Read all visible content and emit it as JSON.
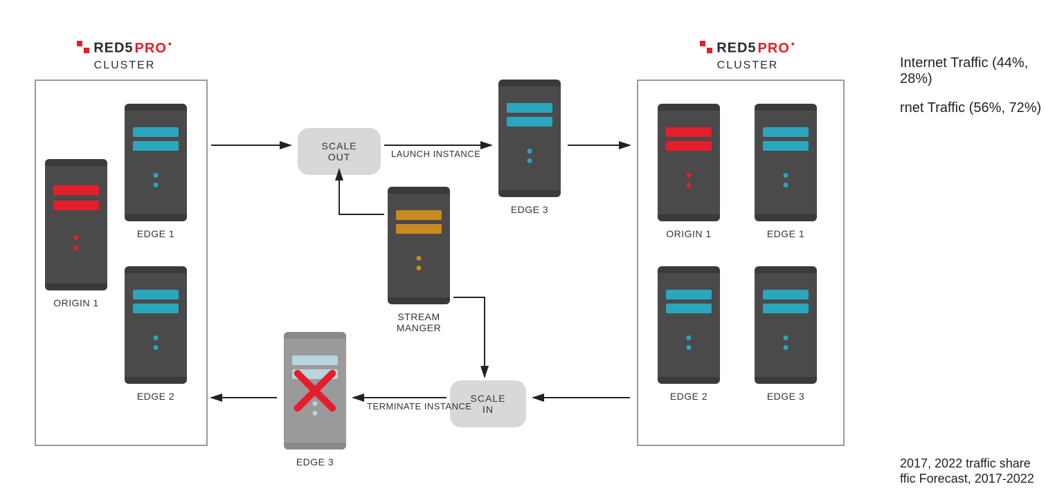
{
  "brand": {
    "red5": "RED5",
    "pro": "PRO",
    "cluster": "CLUSTER"
  },
  "left_cluster": {
    "origin1": "ORIGIN 1",
    "edge1": "EDGE 1",
    "edge2": "EDGE 2"
  },
  "right_cluster": {
    "origin1": "ORIGIN 1",
    "edge1": "EDGE 1",
    "edge2": "EDGE 2",
    "edge3": "EDGE 3"
  },
  "center": {
    "scale_out": "SCALE OUT",
    "scale_in": "SCALE IN",
    "stream_manager": "STREAM MANGER",
    "launch": "LAUNCH INSTANCE",
    "terminate": "TERMINATE INSTANCE",
    "edge3_top": "EDGE 3",
    "edge3_bottom": "EDGE 3"
  },
  "side": {
    "line1": "Internet Traffic (44%, 28%)",
    "line2": "rnet Traffic (56%, 72%)"
  },
  "footer": {
    "line1": "2017, 2022 traffic share",
    "line2": "ffic Forecast, 2017-2022"
  }
}
